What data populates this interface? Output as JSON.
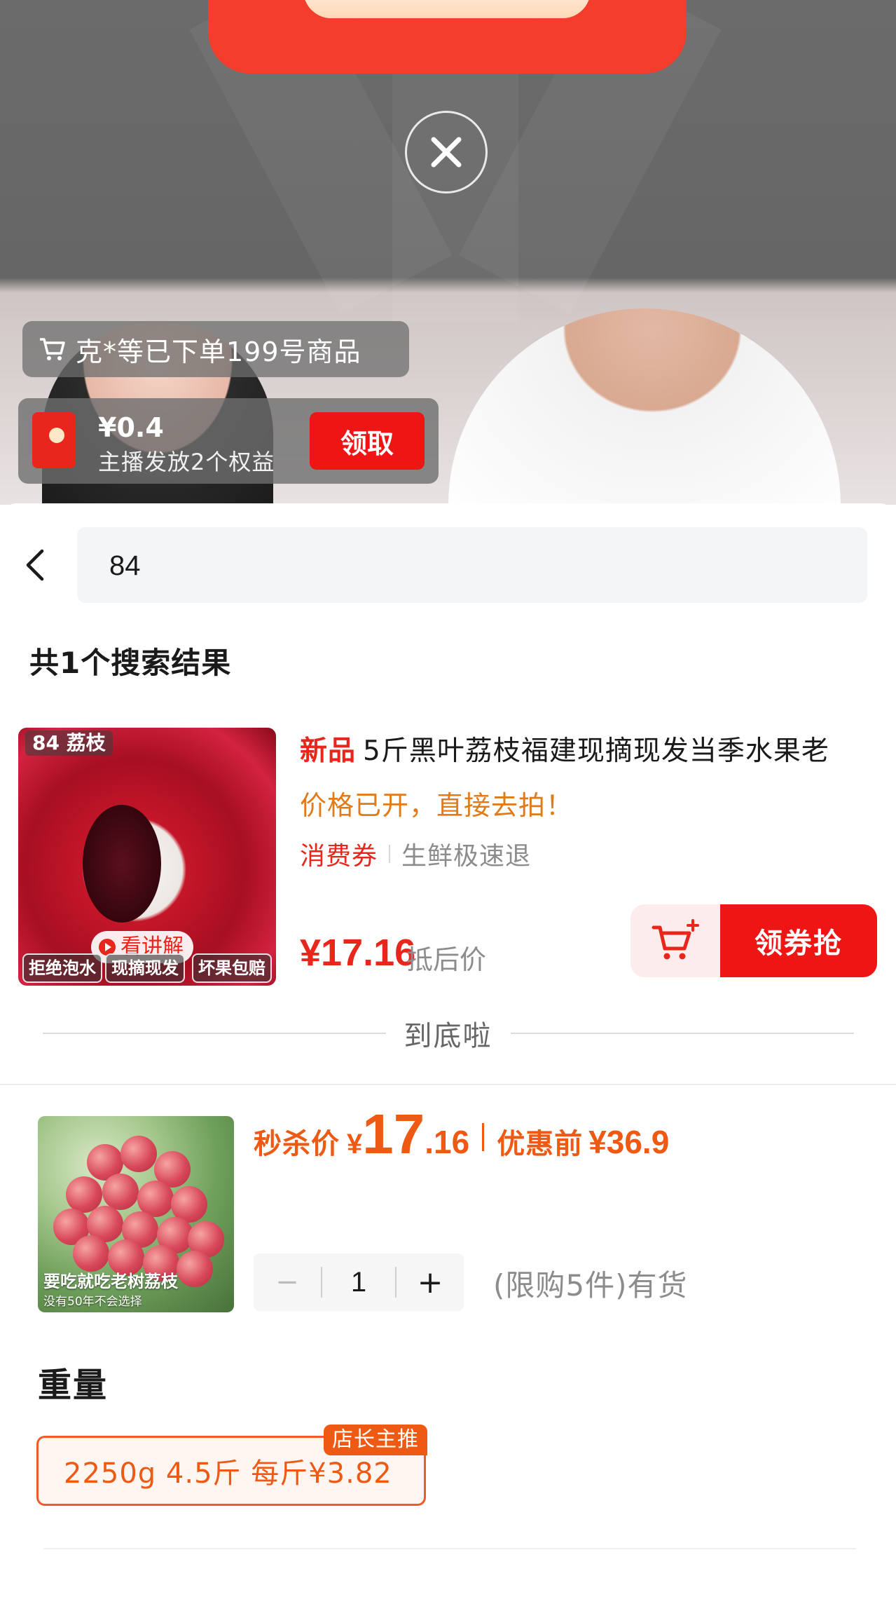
{
  "live": {
    "order_ticker": "克*等已下单199号商品",
    "benefit": {
      "amount": "¥0.4",
      "description": "主播发放2个权益",
      "claim_label": "领取"
    }
  },
  "search": {
    "query": "84",
    "result_count": "共1个搜索结果"
  },
  "product": {
    "thumb_tag": "84 荔枝",
    "video_badge": "看讲解",
    "thumb_chips": [
      "拒绝泡水",
      "现摘现发",
      "坏果包赔"
    ],
    "new_tag": "新品",
    "title": "5斤黑叶荔枝福建现摘现发当季水果老",
    "slogan": "价格已开，直接去拍！",
    "tag_coupon": "消费券",
    "tag_fresh": "生鲜极速退",
    "price": "¥17.16",
    "price_label": "抵后价",
    "grab_label": "领券抢"
  },
  "list_end": "到底啦",
  "sku": {
    "thumb_caption": "要吃就吃老树荔枝",
    "thumb_sub": "没有50年不会选择",
    "seckill_label": "秒杀价",
    "yen": "¥",
    "price_int": "17",
    "price_dec": ".16",
    "original_label": "优惠前",
    "original_price": "¥36.9",
    "qty_minus": "−",
    "quantity": "1",
    "qty_plus": "+",
    "qty_limit": "(限购5件)有货",
    "weight_label": "重量",
    "weight_option": "2250g 4.5斤  每斤¥3.82",
    "weight_badge": "店长主推"
  },
  "colors": {
    "accent_red": "#f01515",
    "accent_orange": "#ee5a14",
    "slogan_orange": "#e07b1b"
  }
}
